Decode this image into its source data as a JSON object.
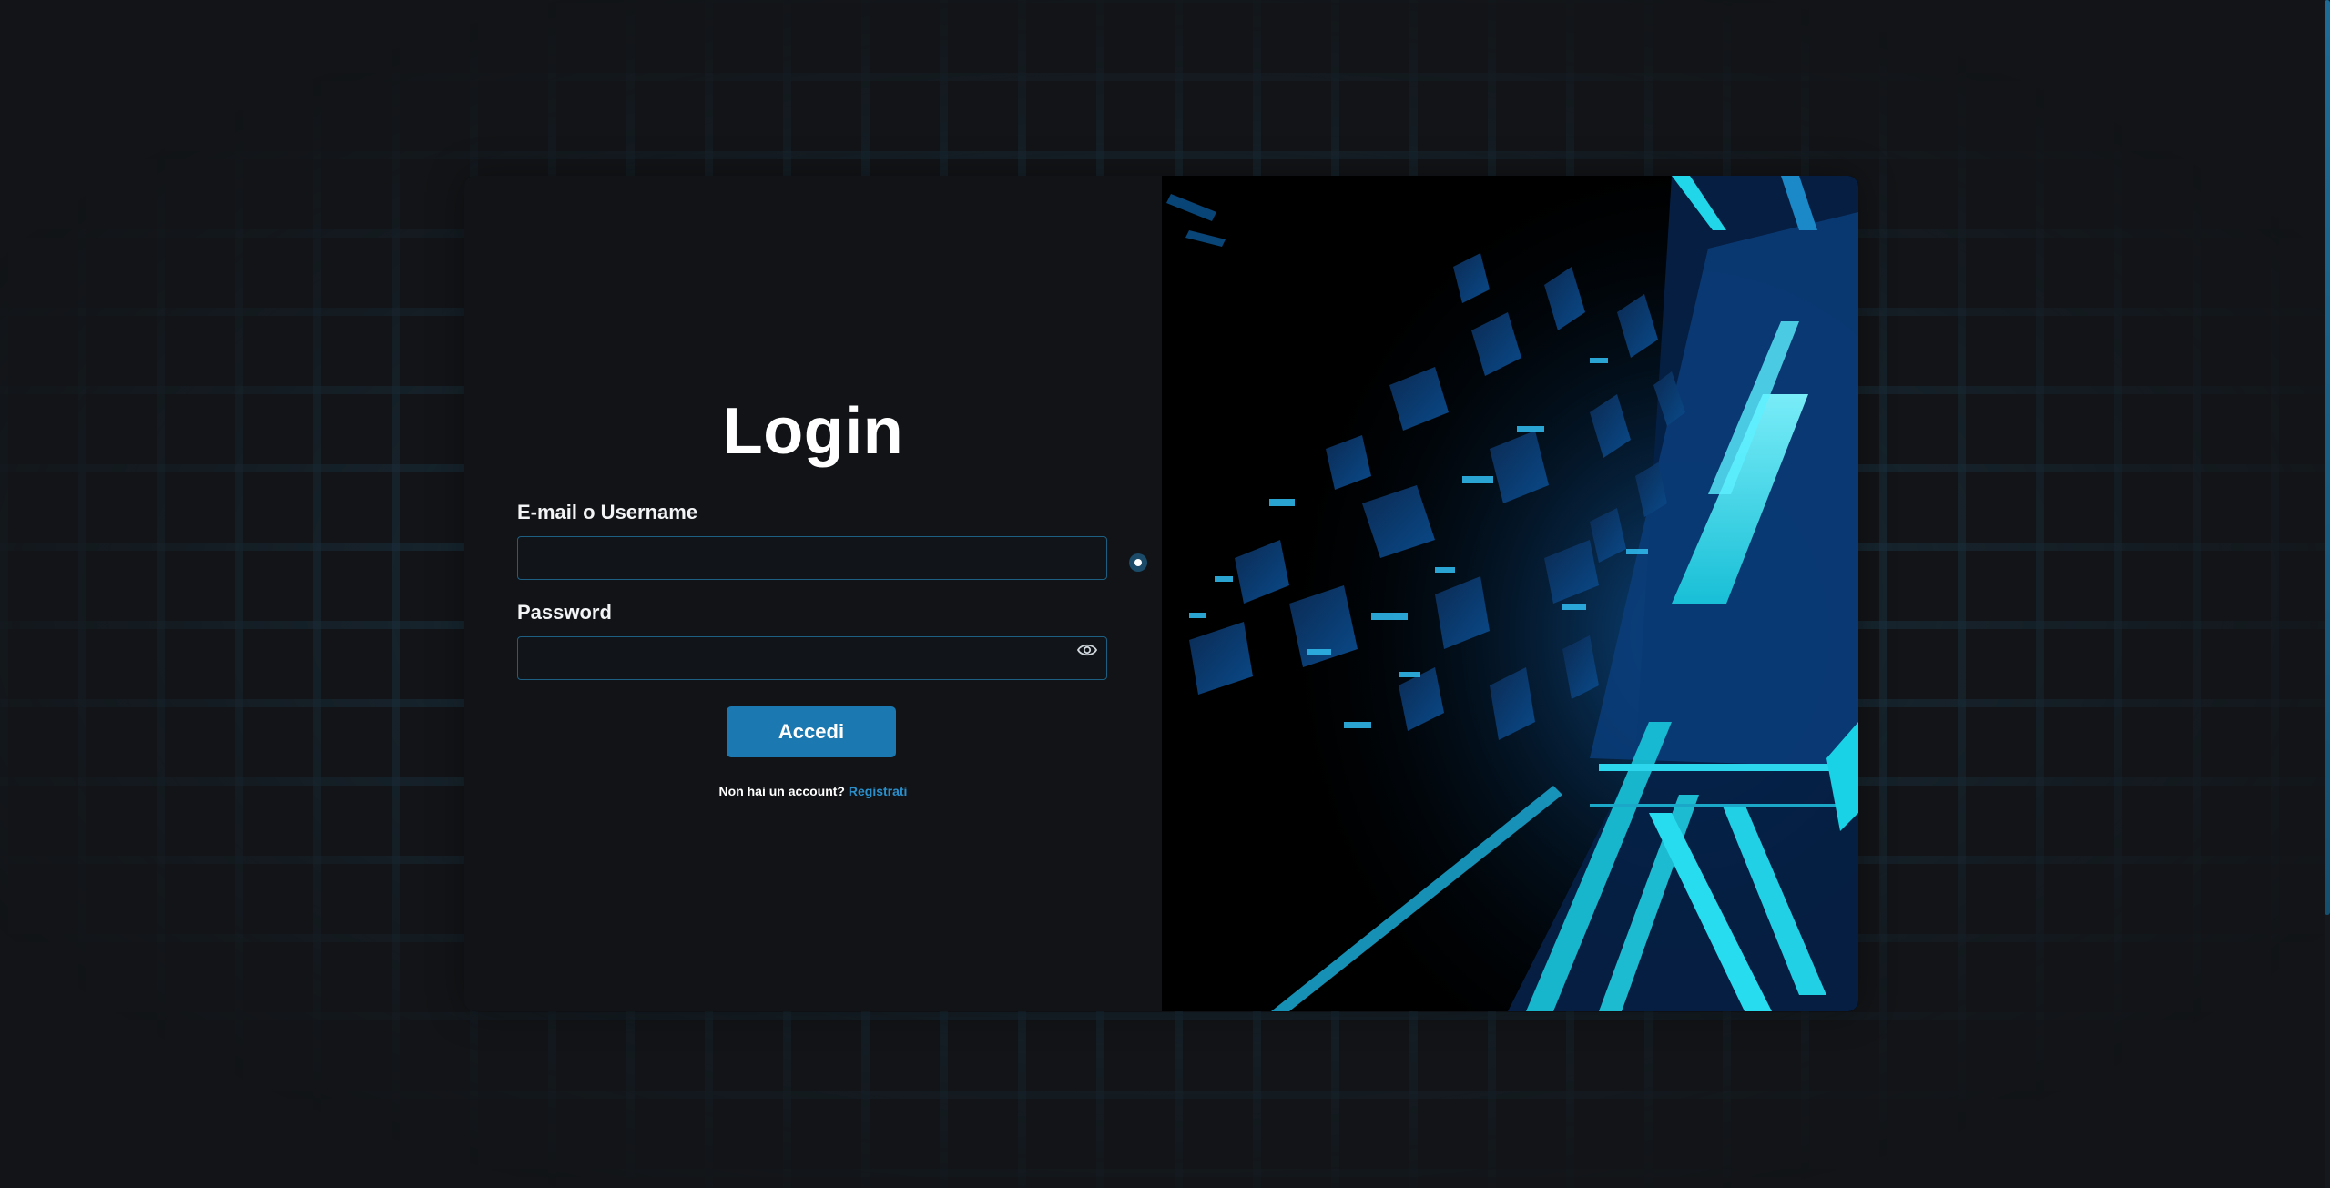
{
  "login": {
    "title": "Login",
    "email_label": "E-mail o Username",
    "email_value": "",
    "password_label": "Password",
    "password_value": "",
    "submit_label": "Accedi",
    "signup_prompt": "Non hai un account?",
    "signup_link": "Registrati"
  },
  "icons": {
    "password_toggle": "eye-icon",
    "illustration": "neon-cube-tunnel"
  },
  "colors": {
    "background": "#121417",
    "accent": "#1b78b1",
    "link": "#2a8fcb",
    "input_border": "#1d5f82",
    "neon_cyan": "#20d6e8"
  }
}
